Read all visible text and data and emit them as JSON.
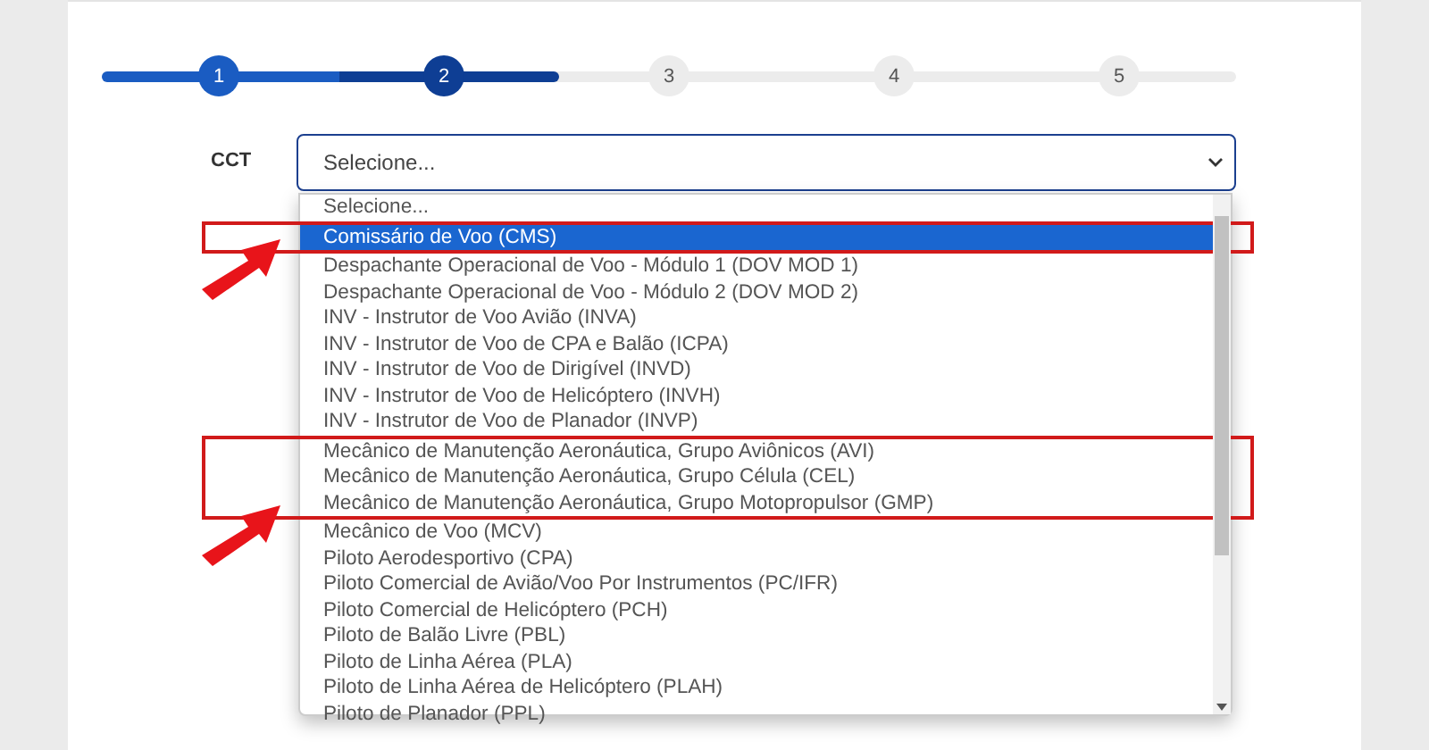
{
  "stepper": {
    "level": 0.403,
    "steps": [
      {
        "label": "1",
        "done": true,
        "current": false
      },
      {
        "label": "2",
        "done": false,
        "current": true
      },
      {
        "label": "3",
        "done": false,
        "current": false
      },
      {
        "label": "4",
        "done": false,
        "current": false
      },
      {
        "label": "5",
        "done": false,
        "current": false
      }
    ]
  },
  "field": {
    "label": "CCT",
    "value": "Selecione...",
    "expanded": true
  },
  "options": [
    {
      "label": "Selecione...",
      "selected": false,
      "highlighted": false
    },
    {
      "label": "Comissário de Voo (CMS)",
      "selected": true,
      "highlighted": true
    },
    {
      "label": "Despachante Operacional de Voo - Módulo 1 (DOV MOD 1)",
      "selected": false,
      "highlighted": false
    },
    {
      "label": "Despachante Operacional de Voo - Módulo 2 (DOV MOD 2)",
      "selected": false,
      "highlighted": false
    },
    {
      "label": "INV - Instrutor de Voo Avião (INVA)",
      "selected": false,
      "highlighted": false
    },
    {
      "label": "INV - Instrutor de Voo de CPA e Balão (ICPA)",
      "selected": false,
      "highlighted": false
    },
    {
      "label": "INV - Instrutor de Voo de Dirigível (INVD)",
      "selected": false,
      "highlighted": false
    },
    {
      "label": "INV - Instrutor de Voo de Helicóptero (INVH)",
      "selected": false,
      "highlighted": false
    },
    {
      "label": "INV - Instrutor de Voo de Planador (INVP)",
      "selected": false,
      "highlighted": false
    },
    {
      "label": "Mecânico de Manutenção Aeronáutica, Grupo Aviônicos (AVI)",
      "selected": false,
      "highlighted": true
    },
    {
      "label": "Mecânico de Manutenção Aeronáutica, Grupo Célula (CEL)",
      "selected": false,
      "highlighted": true
    },
    {
      "label": "Mecânico de Manutenção Aeronáutica, Grupo Motopropulsor (GMP)",
      "selected": false,
      "highlighted": true
    },
    {
      "label": "Mecânico de Voo (MCV)",
      "selected": false,
      "highlighted": false
    },
    {
      "label": "Piloto Aerodesportivo (CPA)",
      "selected": false,
      "highlighted": false
    },
    {
      "label": "Piloto Comercial de Avião/Voo Por Instrumentos (PC/IFR)",
      "selected": false,
      "highlighted": false
    },
    {
      "label": "Piloto Comercial de Helicóptero (PCH)",
      "selected": false,
      "highlighted": false
    },
    {
      "label": "Piloto de Balão Livre (PBL)",
      "selected": false,
      "highlighted": false
    },
    {
      "label": "Piloto de Linha Aérea (PLA)",
      "selected": false,
      "highlighted": false
    },
    {
      "label": "Piloto de Linha Aérea de Helicóptero (PLAH)",
      "selected": false,
      "highlighted": false
    },
    {
      "label": "Piloto de Planador (PPL)",
      "selected": false,
      "highlighted": false
    }
  ]
}
